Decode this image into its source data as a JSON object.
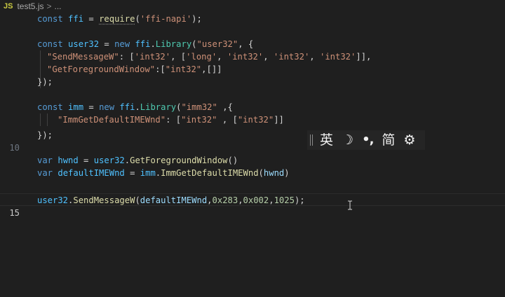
{
  "breadcrumb": {
    "file_icon": "JS",
    "file_name": "test5.js",
    "separator": ">",
    "more": "..."
  },
  "gutter": {
    "line_10": "10",
    "line_15": "15"
  },
  "ime_toolbar": {
    "language": "英",
    "moon_icon": "☽",
    "punctuation": "•,",
    "script": "简",
    "gear_icon": "⚙"
  },
  "code": {
    "l1": {
      "kw": "const",
      "var": "ffi",
      "eq": " = ",
      "fn": "require",
      "open": "(",
      "str": "'ffi-napi'",
      "close": ");"
    },
    "l3": {
      "kw": "const",
      "var": "user32",
      "eq": " = ",
      "new": "new",
      "obj": "ffi",
      "dot": ".",
      "cls": "Library",
      "open": "(",
      "str": "\"user32\"",
      "rest": ", {"
    },
    "l4": {
      "key": "\"SendMessageW\"",
      "colon": ": [",
      "s1": "'int32'",
      "c1": ", [",
      "s2": "'long'",
      "c2": ", ",
      "s3": "'int32'",
      "c3": ", ",
      "s4": "'int32'",
      "c4": ", ",
      "s5": "'int32'",
      "end": "]],"
    },
    "l5": {
      "key": "\"GetForegroundWindow\"",
      "colon": ":[",
      "s1": "\"int32\"",
      "end": ",[]]"
    },
    "l6": {
      "text": "});"
    },
    "l8": {
      "kw": "const",
      "var": "imm",
      "eq": " = ",
      "new": "new",
      "obj": "ffi",
      "dot": ".",
      "cls": "Library",
      "open": "(",
      "str": "\"imm32\"",
      "rest": " ,{"
    },
    "l9": {
      "key": "\"ImmGetDefaultIMEWnd\"",
      "colon": ": [",
      "s1": "\"int32\"",
      "c1": " , [",
      "s2": "\"int32\"",
      "end": "]]"
    },
    "l10": {
      "text": "});"
    },
    "l12": {
      "kw": "var",
      "var": "hwnd",
      "eq": " = ",
      "obj": "user32",
      "dot": ".",
      "fn": "GetForegroundWindow",
      "end": "()"
    },
    "l13": {
      "kw": "var",
      "var": "defaultIMEWnd",
      "eq": " = ",
      "obj": "imm",
      "dot": ".",
      "fn": "ImmGetDefaultIMEWnd",
      "open": "(",
      "arg": "hwnd",
      "end": ")"
    },
    "l15": {
      "obj": "user32",
      "dot": ".",
      "fn": "SendMessageW",
      "open": "(",
      "arg": "defaultIMEWnd",
      "c1": ",",
      "n1": "0x283",
      "c2": ",",
      "n2": "0x002",
      "c3": ",",
      "n3": "1025",
      "end": ");"
    }
  }
}
